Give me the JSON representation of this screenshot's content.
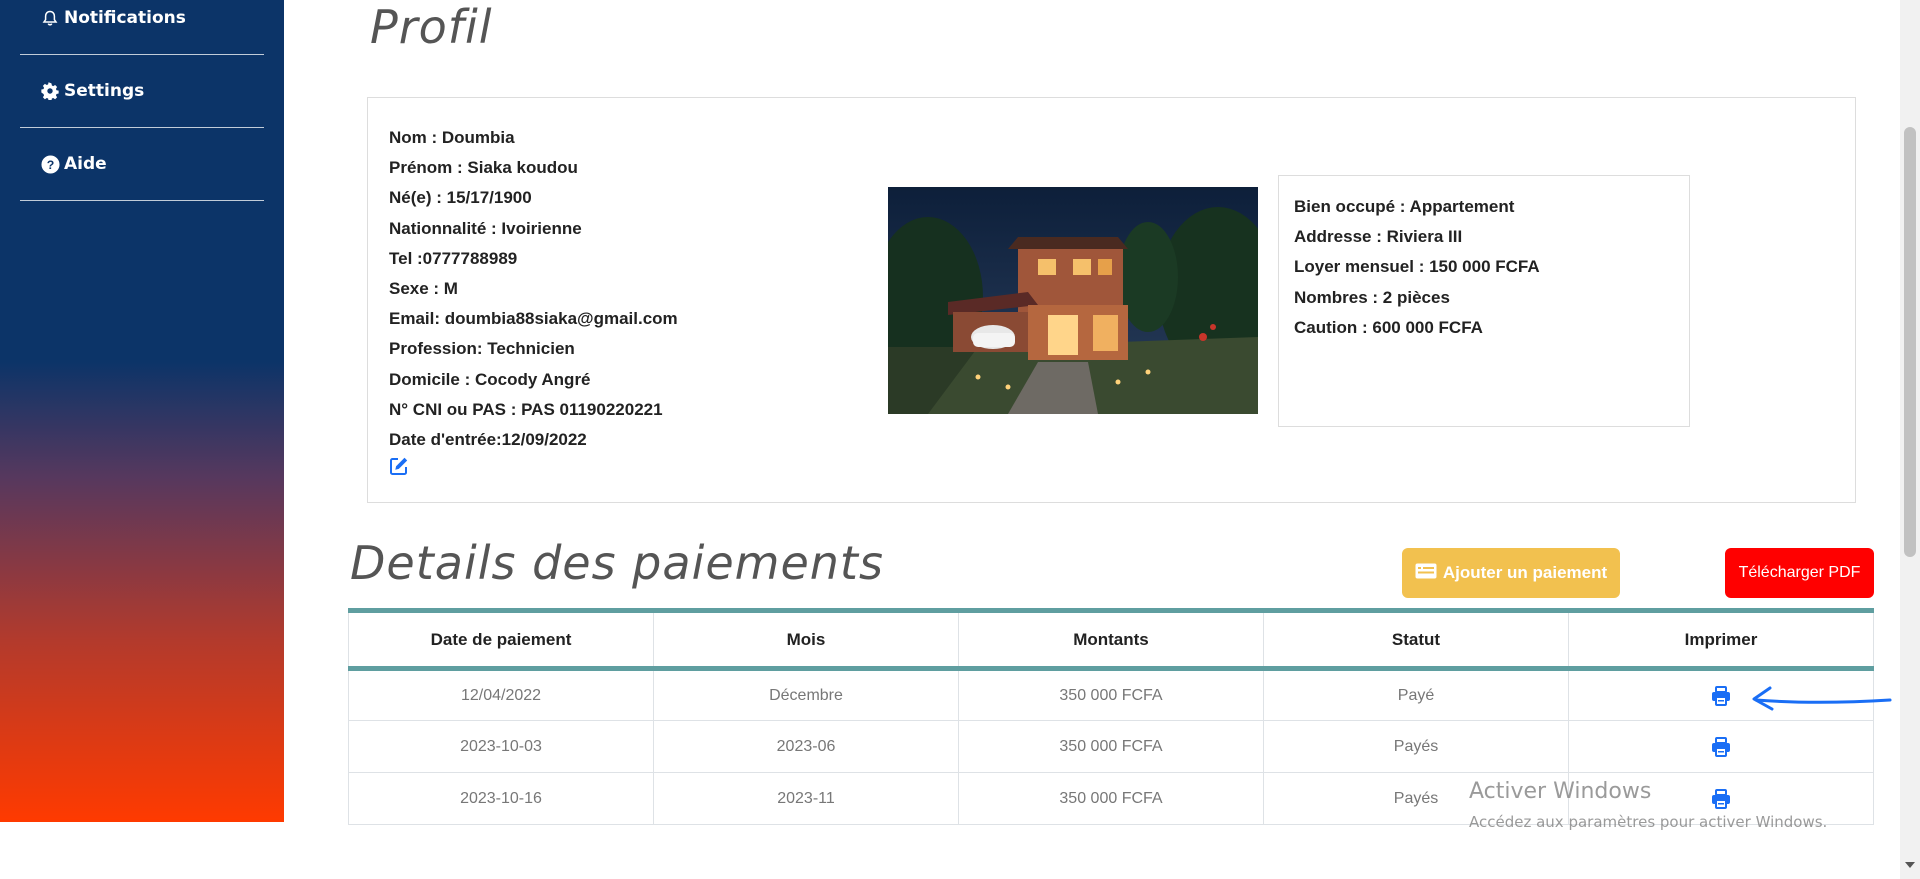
{
  "sidebar": {
    "items": [
      {
        "label": "Notifications",
        "icon": "bell-icon"
      },
      {
        "label": "Settings",
        "icon": "gear-icon"
      },
      {
        "label": "Aide",
        "icon": "help-icon"
      }
    ]
  },
  "profile": {
    "title": "Profil",
    "lines": [
      "Nom : Doumbia",
      "Prénom : Siaka koudou",
      "Né(e) : 15/17/1900",
      "Nationnalité : Ivoirienne",
      "Tel :0777788989",
      "Sexe : M",
      "Email: doumbia88siaka@gmail.com",
      "Profession: Technicien",
      "Domicile : Cocody Angré",
      "N° CNI ou PAS : PAS 01190220221",
      "Date d'entrée:12/09/2022"
    ],
    "property": [
      "Bien occupé : Appartement",
      "Addresse : Riviera III",
      "Loyer mensuel : 150 000 FCFA",
      "Nombres : 2 pièces",
      "Caution : 600 000 FCFA"
    ]
  },
  "payments": {
    "title": "Details des paiements",
    "add_label": "Ajouter un paiement",
    "pdf_label": "Télécharger PDF",
    "headers": [
      "Date de paiement",
      "Mois",
      "Montants",
      "Statut",
      "Imprimer"
    ],
    "rows": [
      [
        "12/04/2022",
        "Décembre",
        "350 000 FCFA",
        "Payé"
      ],
      [
        "2023-10-03",
        "2023-06",
        "350 000 FCFA",
        "Payés"
      ],
      [
        "2023-10-16",
        "2023-11",
        "350 000 FCFA",
        "Payés"
      ]
    ]
  },
  "watermark": {
    "title": "Activer Windows",
    "subtitle": "Accédez aux paramètres pour activer Windows."
  },
  "colors": {
    "accent_blue": "#1a6ef5",
    "table_accent": "#5f9ea0",
    "add_button": "#f2c14f",
    "pdf_button": "#ff0000",
    "sidebar_top": "#0c3468",
    "sidebar_bottom": "#ff3a00"
  }
}
